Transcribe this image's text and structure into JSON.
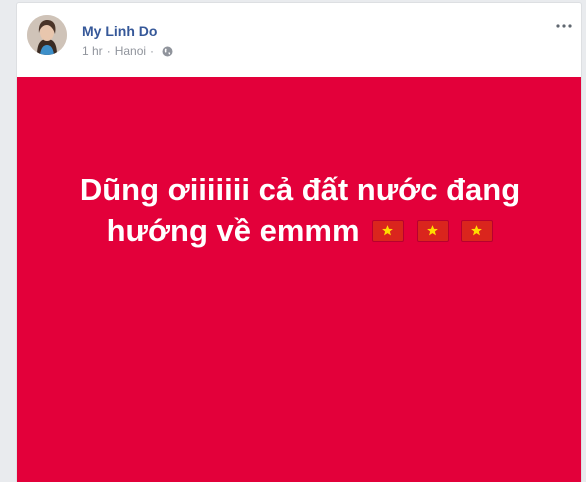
{
  "post": {
    "author_name": "My Linh Do",
    "timestamp": "1 hr",
    "location": "Hanoi",
    "separator": "·",
    "privacy_icon": "globe-icon",
    "options_icon": "more-options-icon",
    "text_line1": "Dũng ơiiiiiii cả đất nước đang",
    "text_line2": "hướng về emmm",
    "emojis": [
      "vietnam-flag",
      "vietnam-flag",
      "vietnam-flag"
    ],
    "background_color": "#e3003a",
    "text_color": "#ffffff",
    "name_color": "#365899"
  }
}
